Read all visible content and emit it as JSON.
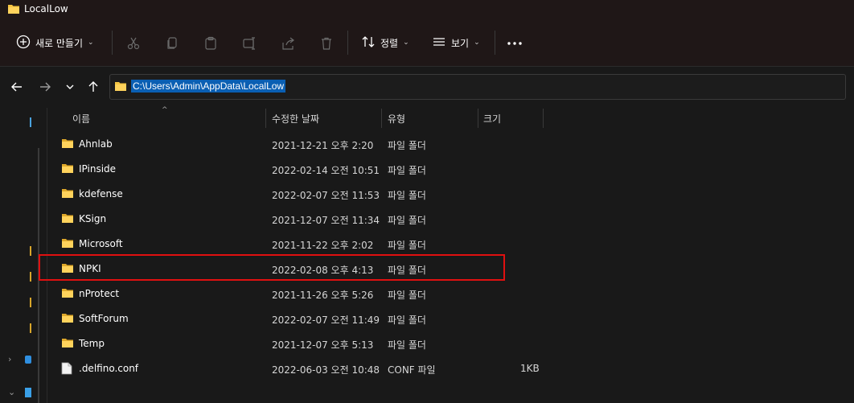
{
  "window": {
    "title": "LocalLow"
  },
  "toolbar": {
    "new_label": "새로 만들기",
    "sort_label": "정렬",
    "view_label": "보기"
  },
  "address": {
    "path": "C:\\Users\\Admin\\AppData\\LocalLow"
  },
  "columns": {
    "name": "이름",
    "date": "수정한 날짜",
    "type": "유형",
    "size": "크기"
  },
  "files": [
    {
      "name": "Ahnlab",
      "date": "2021-12-21 오후 2:20",
      "type": "파일 폴더",
      "size": "",
      "icon": "folder-icon"
    },
    {
      "name": "IPinside",
      "date": "2022-02-14 오전 10:51",
      "type": "파일 폴더",
      "size": "",
      "icon": "folder-icon"
    },
    {
      "name": "kdefense",
      "date": "2022-02-07 오전 11:53",
      "type": "파일 폴더",
      "size": "",
      "icon": "folder-icon"
    },
    {
      "name": "KSign",
      "date": "2021-12-07 오전 11:34",
      "type": "파일 폴더",
      "size": "",
      "icon": "folder-icon"
    },
    {
      "name": "Microsoft",
      "date": "2021-11-22 오후 2:02",
      "type": "파일 폴더",
      "size": "",
      "icon": "folder-icon"
    },
    {
      "name": "NPKI",
      "date": "2022-02-08 오후 4:13",
      "type": "파일 폴더",
      "size": "",
      "icon": "folder-icon"
    },
    {
      "name": "nProtect",
      "date": "2021-11-26 오후 5:26",
      "type": "파일 폴더",
      "size": "",
      "icon": "folder-icon"
    },
    {
      "name": "SoftForum",
      "date": "2022-02-07 오전 11:49",
      "type": "파일 폴더",
      "size": "",
      "icon": "folder-icon"
    },
    {
      "name": "Temp",
      "date": "2021-12-07 오후 5:13",
      "type": "파일 폴더",
      "size": "",
      "icon": "folder-icon"
    },
    {
      "name": ".delfino.conf",
      "date": "2022-06-03 오전 10:48",
      "type": "CONF 파일",
      "size": "1KB",
      "icon": "file-icon"
    }
  ],
  "colors": {
    "folder": "#f5c542",
    "highlight_border": "#e01010",
    "selection": "#0a5fb3"
  }
}
